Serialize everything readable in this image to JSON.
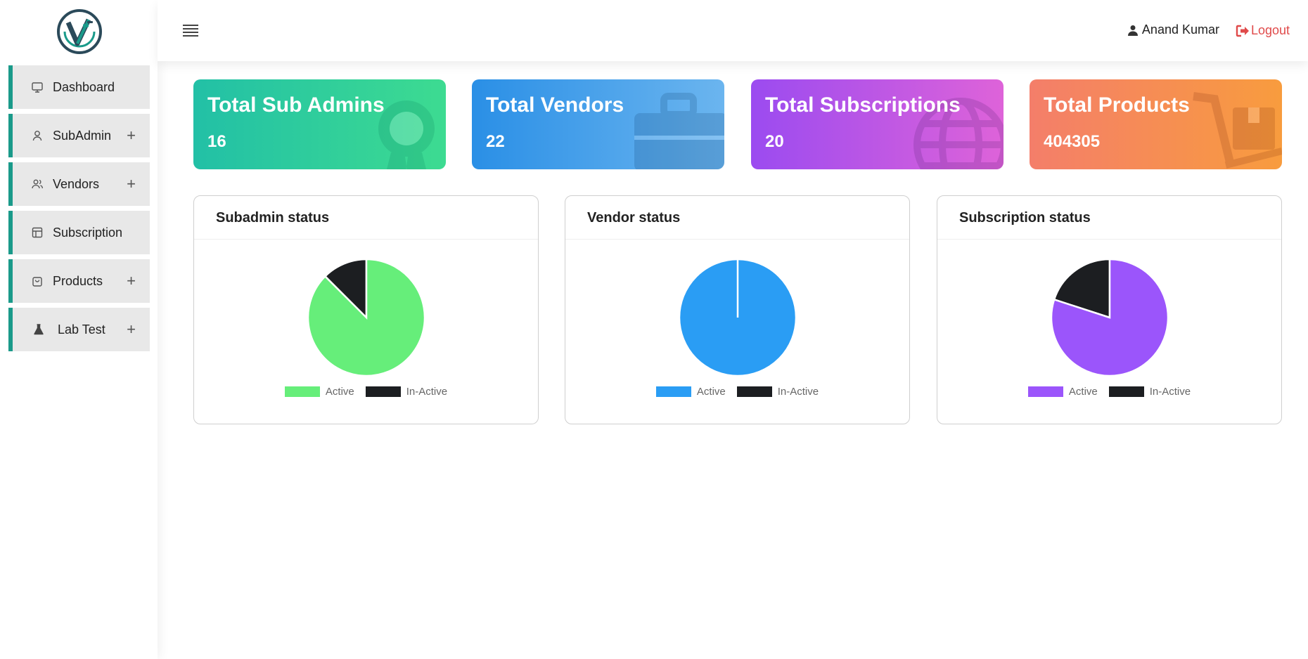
{
  "sidebar": {
    "items": [
      {
        "label": "Dashboard",
        "icon": "monitor-icon",
        "expandable": false
      },
      {
        "label": "SubAdmin",
        "icon": "user-icon",
        "expandable": true
      },
      {
        "label": "Vendors",
        "icon": "users-icon",
        "expandable": true
      },
      {
        "label": "Subscription",
        "icon": "layout-icon",
        "expandable": false
      },
      {
        "label": "Products",
        "icon": "bag-icon",
        "expandable": true
      },
      {
        "label": "Lab Test",
        "icon": "flask-icon",
        "expandable": true
      }
    ],
    "plus": "+"
  },
  "header": {
    "user_name": "Anand Kumar",
    "logout_label": "Logout"
  },
  "stats": [
    {
      "title": "Total Sub Admins",
      "value": "16"
    },
    {
      "title": "Total Vendors",
      "value": "22"
    },
    {
      "title": "Total Subscriptions",
      "value": "20"
    },
    {
      "title": "Total Products",
      "value": "404305"
    }
  ],
  "colors": {
    "accent": "#1a9a8a",
    "logout": "#e04a4a",
    "inactive": "#1c1e21"
  },
  "chart_data": [
    {
      "type": "pie",
      "title": "Subadmin status",
      "categories": [
        "Active",
        "In-Active"
      ],
      "values": [
        14,
        2
      ],
      "colors": [
        "#66ee7a",
        "#1c1e21"
      ],
      "legend": "bottom"
    },
    {
      "type": "pie",
      "title": "Vendor status",
      "categories": [
        "Active",
        "In-Active"
      ],
      "values": [
        22,
        0
      ],
      "colors": [
        "#2a9df4",
        "#1c1e21"
      ],
      "legend": "bottom"
    },
    {
      "type": "pie",
      "title": "Subscription status",
      "categories": [
        "Active",
        "In-Active"
      ],
      "values": [
        16,
        4
      ],
      "colors": [
        "#9b55fb",
        "#1c1e21"
      ],
      "legend": "bottom"
    }
  ]
}
